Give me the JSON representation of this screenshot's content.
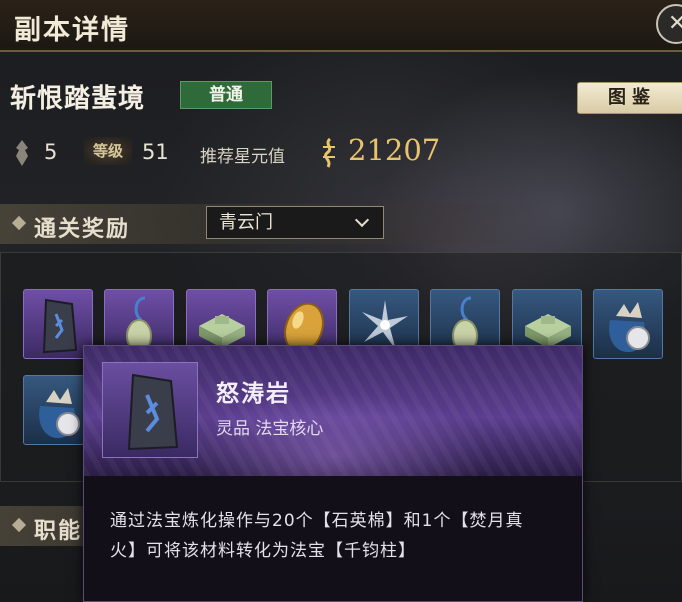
{
  "window": {
    "title": "副本详情",
    "close_label": "✕"
  },
  "dungeon": {
    "name": "斩恨踏蜚境",
    "difficulty": "普通",
    "codex_button": "图鉴",
    "players": "5",
    "level_label": "等级",
    "level": "51",
    "power_label": "推荐星元值",
    "power": "21207"
  },
  "rewards": {
    "section_label": "通关奖励",
    "sect_selected": "青云门",
    "items": [
      {
        "icon": "rune-stone-icon",
        "rarity": "purple"
      },
      {
        "icon": "jade-pendant-icon",
        "rarity": "purple"
      },
      {
        "icon": "jade-seal-icon",
        "rarity": "purple"
      },
      {
        "icon": "amber-crystal-icon",
        "rarity": "purple"
      },
      {
        "icon": "spirit-wisp-icon",
        "rarity": "blue"
      },
      {
        "icon": "jade-pendant-icon",
        "rarity": "blue"
      },
      {
        "icon": "jade-seal-icon",
        "rarity": "blue"
      },
      {
        "icon": "coin-pouch-icon",
        "rarity": "blue"
      },
      {
        "icon": "coin-pouch-icon",
        "rarity": "blue"
      }
    ]
  },
  "jobs": {
    "section_label": "职能"
  },
  "tooltip": {
    "name": "怒涛岩",
    "type": "灵品  法宝核心",
    "description": "通过法宝炼化操作与20个【石英棉】和1个【焚月真火】可将该材料转化为法宝【千钧柱】"
  },
  "colors": {
    "accent_gold": "#e8c46a",
    "difficulty_green": "#2f6b3a",
    "rarity_purple": "#6f4fa6",
    "rarity_blue": "#36587f"
  }
}
